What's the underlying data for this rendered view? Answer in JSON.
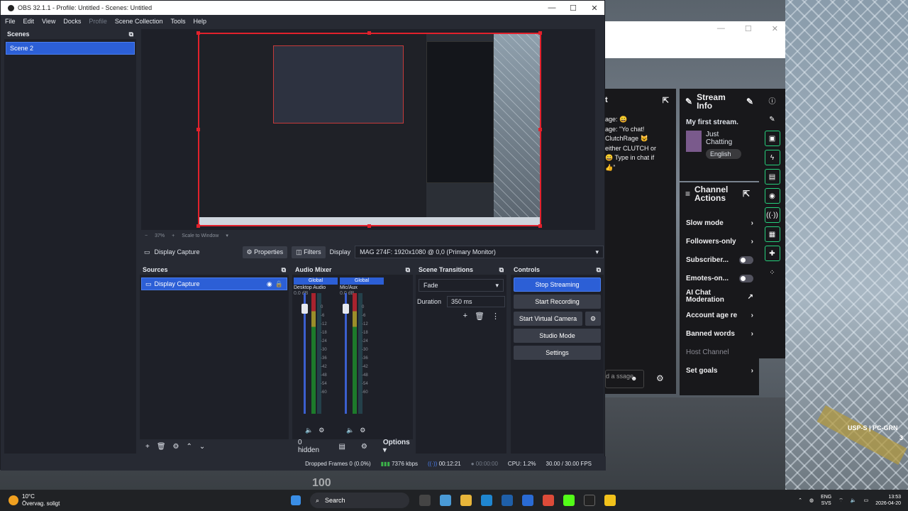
{
  "obs": {
    "title": "OBS 32.1.1 - Profile: Untitled - Scenes: Untitled",
    "menu": [
      "File",
      "Edit",
      "View",
      "Docks",
      "Profile",
      "Scene Collection",
      "Tools",
      "Help"
    ],
    "scenes": {
      "header": "Scenes",
      "items": [
        "Scene 2"
      ]
    },
    "preview": {
      "zoom": "37%",
      "scale_label": "Scale to Window"
    },
    "source_bar": {
      "source_name": "Display Capture",
      "properties": "Properties",
      "filters": "Filters",
      "display_label": "Display",
      "display_value": "MAG 274F: 1920x1080 @ 0,0 (Primary Monitor)"
    },
    "sources": {
      "header": "Sources",
      "items": [
        "Display Capture"
      ]
    },
    "mixer": {
      "header": "Audio Mixer",
      "channels": [
        {
          "tag": "Global",
          "name": "Desktop Audio",
          "db": "0.0 dB"
        },
        {
          "tag": "Global",
          "name": "Mic/Aux",
          "db": "0.0 dB"
        }
      ],
      "scale": [
        "0",
        "-6",
        "-12",
        "-18",
        "-24",
        "-30",
        "-36",
        "-42",
        "-48",
        "-54",
        "-60"
      ],
      "hidden": "0 hidden",
      "options": "Options"
    },
    "transitions": {
      "header": "Scene Transitions",
      "type": "Fade",
      "duration_label": "Duration",
      "duration_value": "350 ms"
    },
    "controls": {
      "header": "Controls",
      "stop_streaming": "Stop Streaming",
      "start_recording": "Start Recording",
      "start_virtual_camera": "Start Virtual Camera",
      "studio_mode": "Studio Mode",
      "settings": "Settings"
    },
    "status": {
      "dropped": "Dropped Frames 0 (0.0%)",
      "bitrate": "7376 kbps",
      "stream_time": "00:12:21",
      "rec_time": "00:00:00",
      "cpu": "CPU: 1.2%",
      "fps": "30.00 / 30.00 FPS"
    }
  },
  "twitch": {
    "chat_header": "t",
    "chat_lines": [
      "age: 😀",
      "age: \"Yo chat!",
      "ClutchRage 😺",
      "either CLUTCH or",
      "😀 Type in chat if",
      "👍”"
    ],
    "chat_input": "d a ssage",
    "stream_info": {
      "header": "Stream Info",
      "title": "My first stream.",
      "category": "Just Chatting",
      "tag": "English"
    },
    "channel_actions": {
      "header": "Channel Actions",
      "items": [
        "Slow mode",
        "Followers-only",
        "Subscriber...",
        "Emotes-on...",
        "AI Chat Moderation",
        "Account age re",
        "Banned words",
        "Host Channel",
        "Set goals"
      ]
    }
  },
  "game_hud": {
    "weapon": "USP-S | PC-GRN",
    "ammo": "3",
    "left_number": "100"
  },
  "taskbar": {
    "weather_temp": "10°C",
    "weather_desc": "Övervag. soligt",
    "search": "Search",
    "lang": "ENG",
    "lang2": "SVS",
    "time": "13:53",
    "date": "2026-04-20"
  },
  "colors": {
    "accent": "#2c5fd6",
    "danger": "#e2212c",
    "twitch_green": "#26d07c"
  }
}
